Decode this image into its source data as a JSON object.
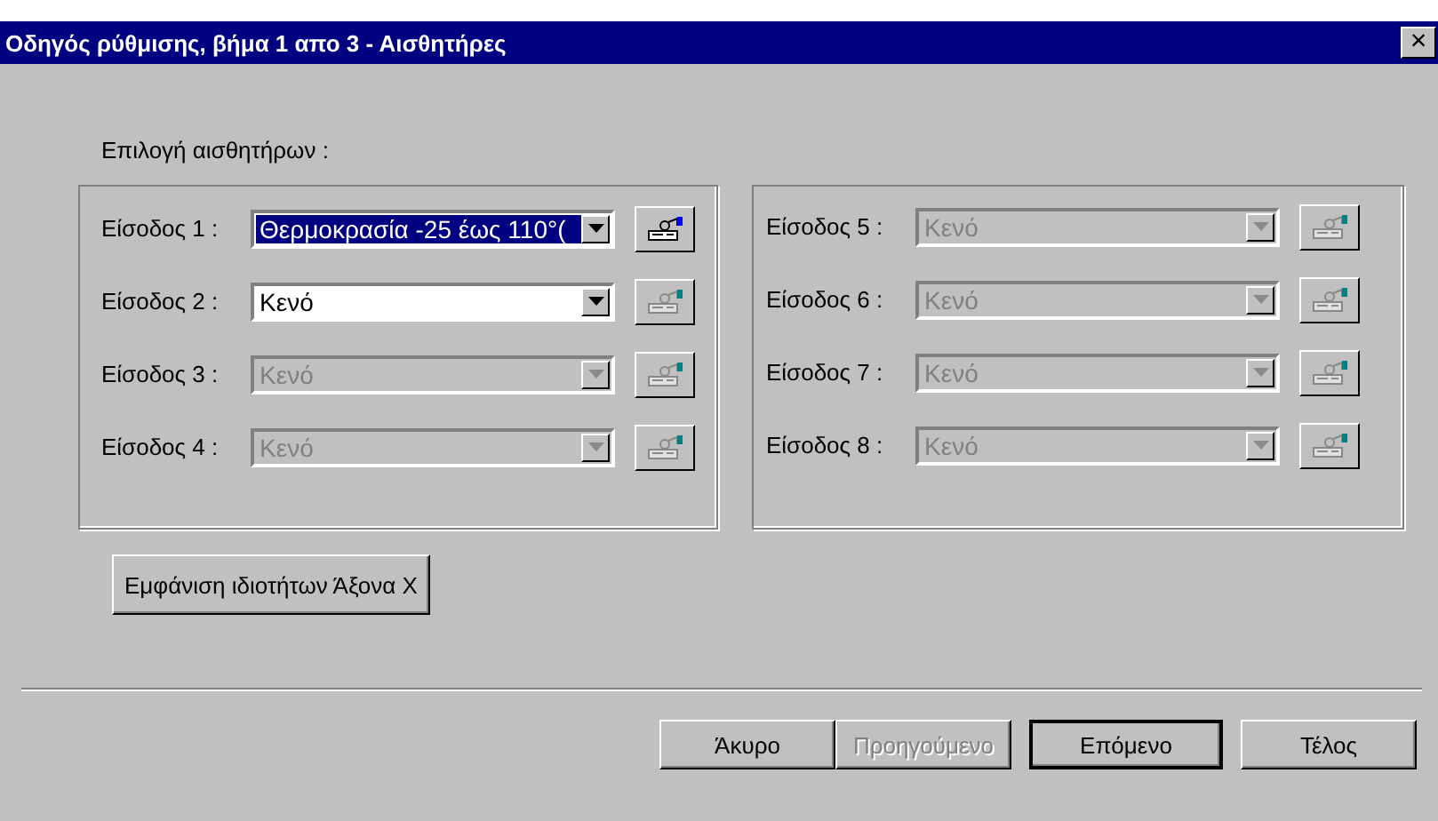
{
  "window": {
    "title": "Οδηγός ρύθμισης, βήμα 1 απο 3 - Αισθητήρες",
    "close": "×"
  },
  "section_label": "Επιλογή αισθητήρων :",
  "groups": [
    {
      "inputs": [
        {
          "label": "Είσοδος 1 :",
          "value": "Θερμοκρασία -25 έως 110°(",
          "selected": true,
          "disabled": false,
          "icon_disabled": false
        },
        {
          "label": "Είσοδος 2 :",
          "value": "Κενό",
          "selected": false,
          "disabled": false,
          "icon_disabled": true
        },
        {
          "label": "Είσοδος 3 :",
          "value": "Κενό",
          "selected": false,
          "disabled": true,
          "icon_disabled": true
        },
        {
          "label": "Είσοδος 4 :",
          "value": "Κενό",
          "selected": false,
          "disabled": true,
          "icon_disabled": true
        }
      ]
    },
    {
      "inputs": [
        {
          "label": "Είσοδος 5 :",
          "value": "Κενό",
          "selected": false,
          "disabled": true,
          "icon_disabled": true
        },
        {
          "label": "Είσοδος 6 :",
          "value": "Κενό",
          "selected": false,
          "disabled": true,
          "icon_disabled": true
        },
        {
          "label": "Είσοδος 7 :",
          "value": "Κενό",
          "selected": false,
          "disabled": true,
          "icon_disabled": true
        },
        {
          "label": "Είσοδος 8 :",
          "value": "Κενό",
          "selected": false,
          "disabled": true,
          "icon_disabled": true
        }
      ]
    }
  ],
  "axis_button": "Εμφάνιση ιδιοτήτων Άξονα X",
  "buttons": [
    {
      "label": "Άκυρο",
      "disabled": false,
      "default": false
    },
    {
      "label": "Προηγούμενο",
      "disabled": true,
      "default": false
    },
    {
      "label": "Επόμενο",
      "disabled": false,
      "default": true
    },
    {
      "label": "Τέλος",
      "disabled": false,
      "default": false
    }
  ]
}
